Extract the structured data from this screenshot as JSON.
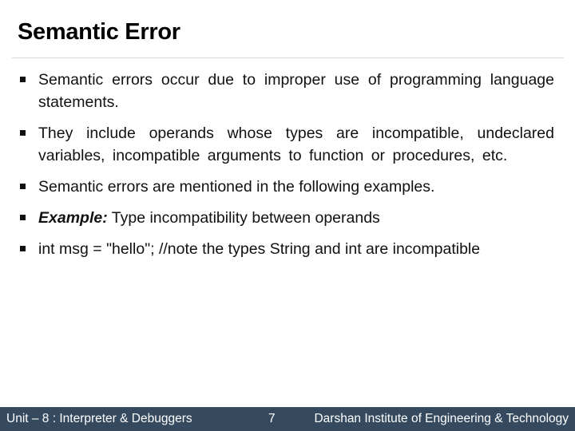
{
  "slide": {
    "title": "Semantic Error",
    "bullets": [
      {
        "icon": "square-bullet-icon",
        "text": "Semantic errors occur due to improper use of programming language statements."
      },
      {
        "icon": "square-bullet-icon",
        "text": "They include operands whose types are incompatible, undeclared variables, incompatible arguments to function or procedures, etc."
      },
      {
        "icon": "square-bullet-icon",
        "text": "Semantic errors are mentioned in the following examples."
      },
      {
        "icon": "square-bullet-icon",
        "label": "Example:",
        "text": " Type incompatibility between operands"
      },
      {
        "icon": "square-bullet-icon",
        "text": "int msg = \"hello\"; //note the types String and int are incompatible"
      }
    ]
  },
  "footer": {
    "unit": "Unit – 8 : Interpreter & Debuggers",
    "page_number": "7",
    "institute": "Darshan Institute of Engineering & Technology",
    "background_color": "#354a5e"
  }
}
